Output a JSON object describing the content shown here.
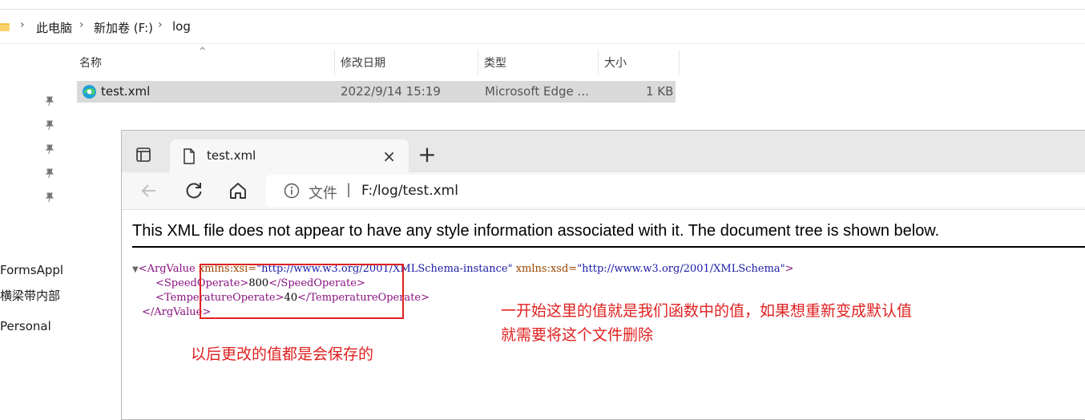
{
  "explorer": {
    "breadcrumb": [
      "此电脑",
      "新加卷 (F:)",
      "log"
    ],
    "columns": {
      "name": "名称",
      "modified": "修改日期",
      "type": "类型",
      "size": "大小"
    },
    "file": {
      "name": "test.xml",
      "modified": "2022/9/14 15:19",
      "type": "Microsoft Edge ...",
      "size": "1 KB"
    },
    "sidebar_partial": [
      "FormsAppl",
      "横梁带内部",
      "Personal"
    ]
  },
  "browser": {
    "tab_title": "test.xml",
    "tab_close": "×",
    "new_tab": "+",
    "address_scheme": "文件",
    "address_divider": "|",
    "address_url": "F:/log/test.xml",
    "notice": "This XML file does not appear to have any style information associated with it. The document tree is shown below.",
    "xml": {
      "arrow": "▼",
      "root_tag": "ArgValue",
      "attr1_name": "xmlns:xsi",
      "attr1_value": "\"http://www.w3.org/2001/XMLSchema-instance\"",
      "attr2_name": "xmlns:xsd",
      "attr2_value": "\"http://www.w3.org/2001/XMLSchema\"",
      "speed_tag": "SpeedOperate",
      "speed_value": "800",
      "temp_tag": "TemperatureOperate",
      "temp_value": "40"
    }
  },
  "annotations": {
    "right_line1": "一开始这里的值就是我们函数中的值，如果想重新变成默认值",
    "right_line2": "就需要将这个文件删除",
    "left": "以后更改的值都是会保存的"
  },
  "colors": {
    "annotation_red": "#e02020",
    "xml_tag": "#881280",
    "xml_attr": "#994500",
    "xml_value": "#1a1aa6"
  },
  "icons": [
    "folder-icon",
    "pin-icon",
    "edge-icon",
    "workspaces-icon",
    "document-icon",
    "back-arrow-icon",
    "refresh-icon",
    "home-icon",
    "info-icon"
  ]
}
